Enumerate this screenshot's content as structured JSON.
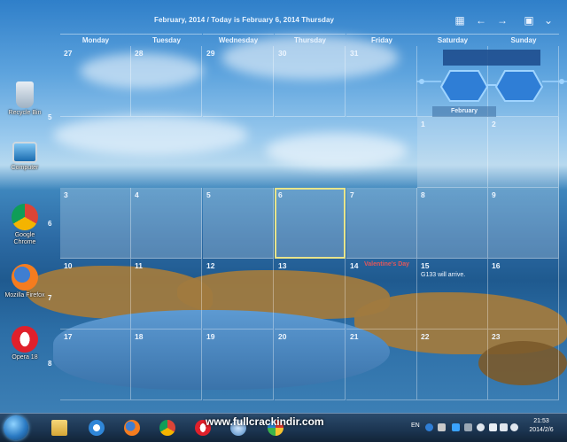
{
  "calendar": {
    "title": "February, 2014 / Today is February 6, 2014 Thursday",
    "weekdays": [
      "Monday",
      "Tuesday",
      "Wednesday",
      "Thursday",
      "Friday",
      "Saturday",
      "Sunday"
    ],
    "week_numbers": [
      "5",
      "6",
      "7",
      "8"
    ],
    "rows": [
      [
        "27",
        "28",
        "29",
        "30",
        "31",
        "",
        ""
      ],
      [
        "",
        "",
        "",
        "",
        "",
        "1",
        "2"
      ],
      [
        "3",
        "4",
        "5",
        "6",
        "7",
        "8",
        "9"
      ],
      [
        "10",
        "11",
        "12",
        "13",
        "14",
        "15",
        "16"
      ],
      [
        "17",
        "18",
        "19",
        "20",
        "21",
        "22",
        "23"
      ]
    ],
    "today": "6",
    "holiday_label": "Valentine's Day",
    "event_text": "G133 will arrive.",
    "mini_month_label": "February"
  },
  "desktop_icons": [
    {
      "label": "Recycle Bin",
      "icon": "recycle-bin-icon"
    },
    {
      "label": "Computer",
      "icon": "computer-icon"
    },
    {
      "label": "Google Chrome",
      "icon": "chrome-icon"
    },
    {
      "label": "Mozilla Firefox",
      "icon": "firefox-icon"
    },
    {
      "label": "Opera 18",
      "icon": "opera-icon"
    }
  ],
  "taskbar": {
    "watermark": "www.fullcrackindir.com",
    "language": "EN",
    "time": "21:53",
    "date": "2014/2/6"
  },
  "colors": {
    "today_outline": "#e8e48a",
    "holiday_text": "#e0575b"
  }
}
